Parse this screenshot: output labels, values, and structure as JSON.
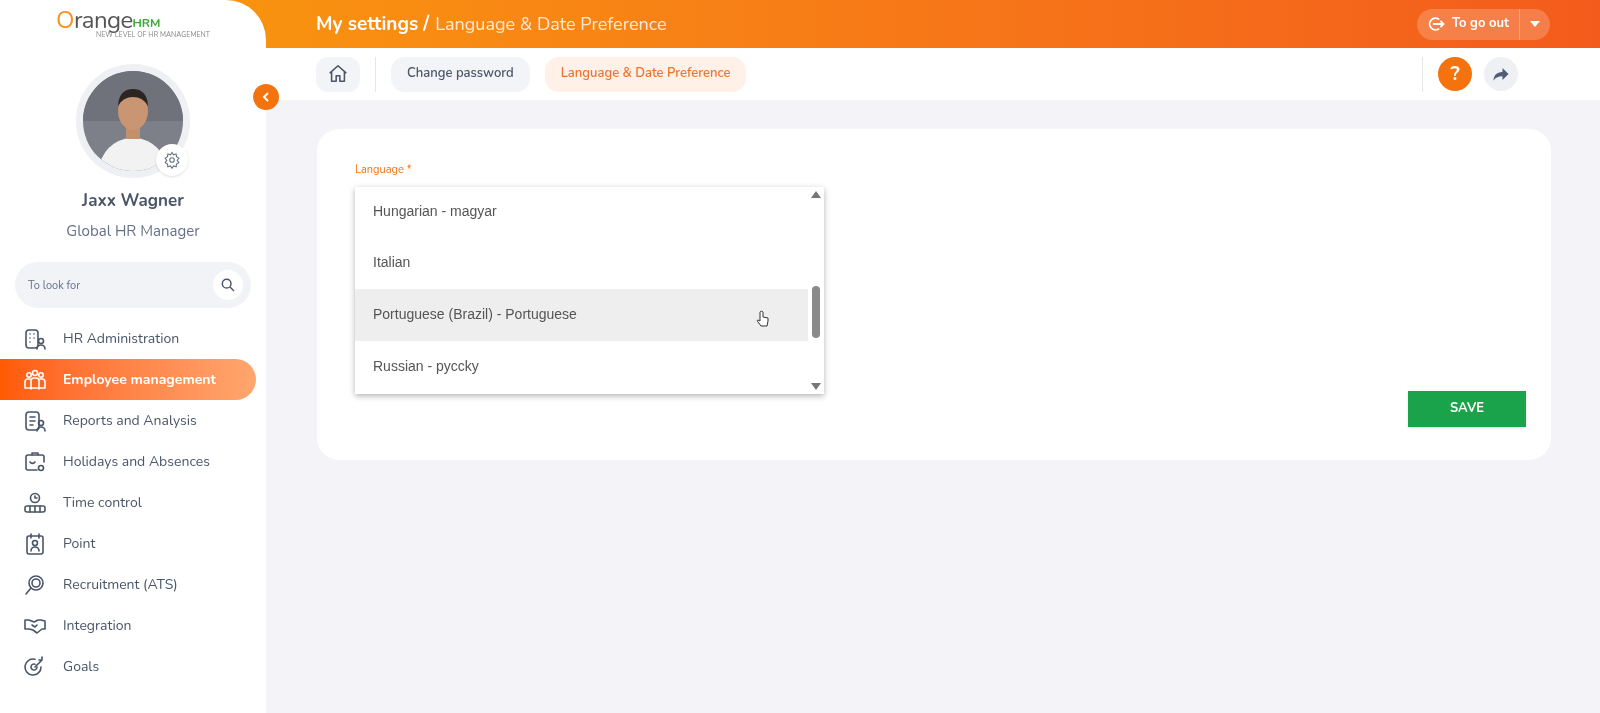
{
  "logo": {
    "brand": "Orange",
    "brand_suffix": "HRM",
    "tagline": "NEW LEVEL OF HR MANAGEMENT"
  },
  "profile": {
    "name": "Jaxx Wagner",
    "role": "Global HR Manager"
  },
  "sidebar": {
    "search": {
      "placeholder": "To look for"
    },
    "items": [
      {
        "label": "HR Administration",
        "selected": false
      },
      {
        "label": "Employee management",
        "selected": true
      },
      {
        "label": "Reports and Analysis",
        "selected": false
      },
      {
        "label": "Holidays and Absences",
        "selected": false
      },
      {
        "label": "Time control",
        "selected": false
      },
      {
        "label": "Point",
        "selected": false
      },
      {
        "label": "Recruitment (ATS)",
        "selected": false
      },
      {
        "label": "Integration",
        "selected": false
      },
      {
        "label": "Goals",
        "selected": false
      }
    ]
  },
  "header": {
    "title": "My settings /",
    "subtitle": "Language & Date Preference",
    "logout_button": "To go out"
  },
  "tabs": [
    {
      "label": "Change password",
      "selected": false
    },
    {
      "label": "Language & Date Preference",
      "selected": true
    }
  ],
  "form": {
    "language_label": "Language",
    "required_mark": "*",
    "options": [
      {
        "label": "Hungarian - magyar",
        "hovered": false
      },
      {
        "label": "Italian",
        "hovered": false
      },
      {
        "label": "Portuguese (Brazil) - Portuguese",
        "hovered": true
      },
      {
        "label": "Russian - pyccky",
        "hovered": false
      }
    ],
    "save_button": "SAVE"
  },
  "help_button": "?"
}
